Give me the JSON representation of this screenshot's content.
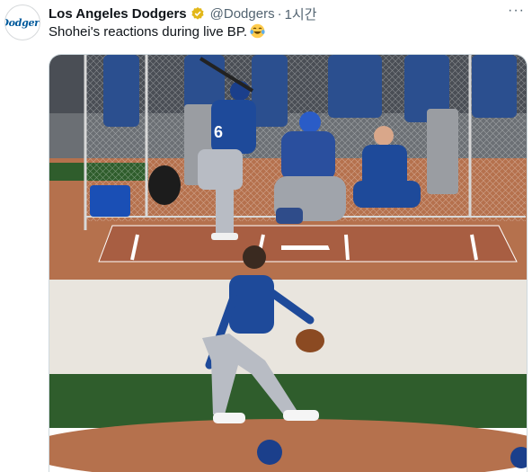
{
  "tweet": {
    "avatar_text": "Dodgers",
    "display_name": "Los Angeles Dodgers",
    "handle": "@Dodgers",
    "separator": "·",
    "time": "1시간",
    "text": "Shohei's reactions during live BP.",
    "more_label": "···"
  },
  "media": {
    "jersey_number": "6"
  },
  "colors": {
    "dodger_blue": "#005a9c",
    "verified_gold": "#e2b719",
    "field_green": "#2f5d2c",
    "dirt": "#b5714d"
  }
}
